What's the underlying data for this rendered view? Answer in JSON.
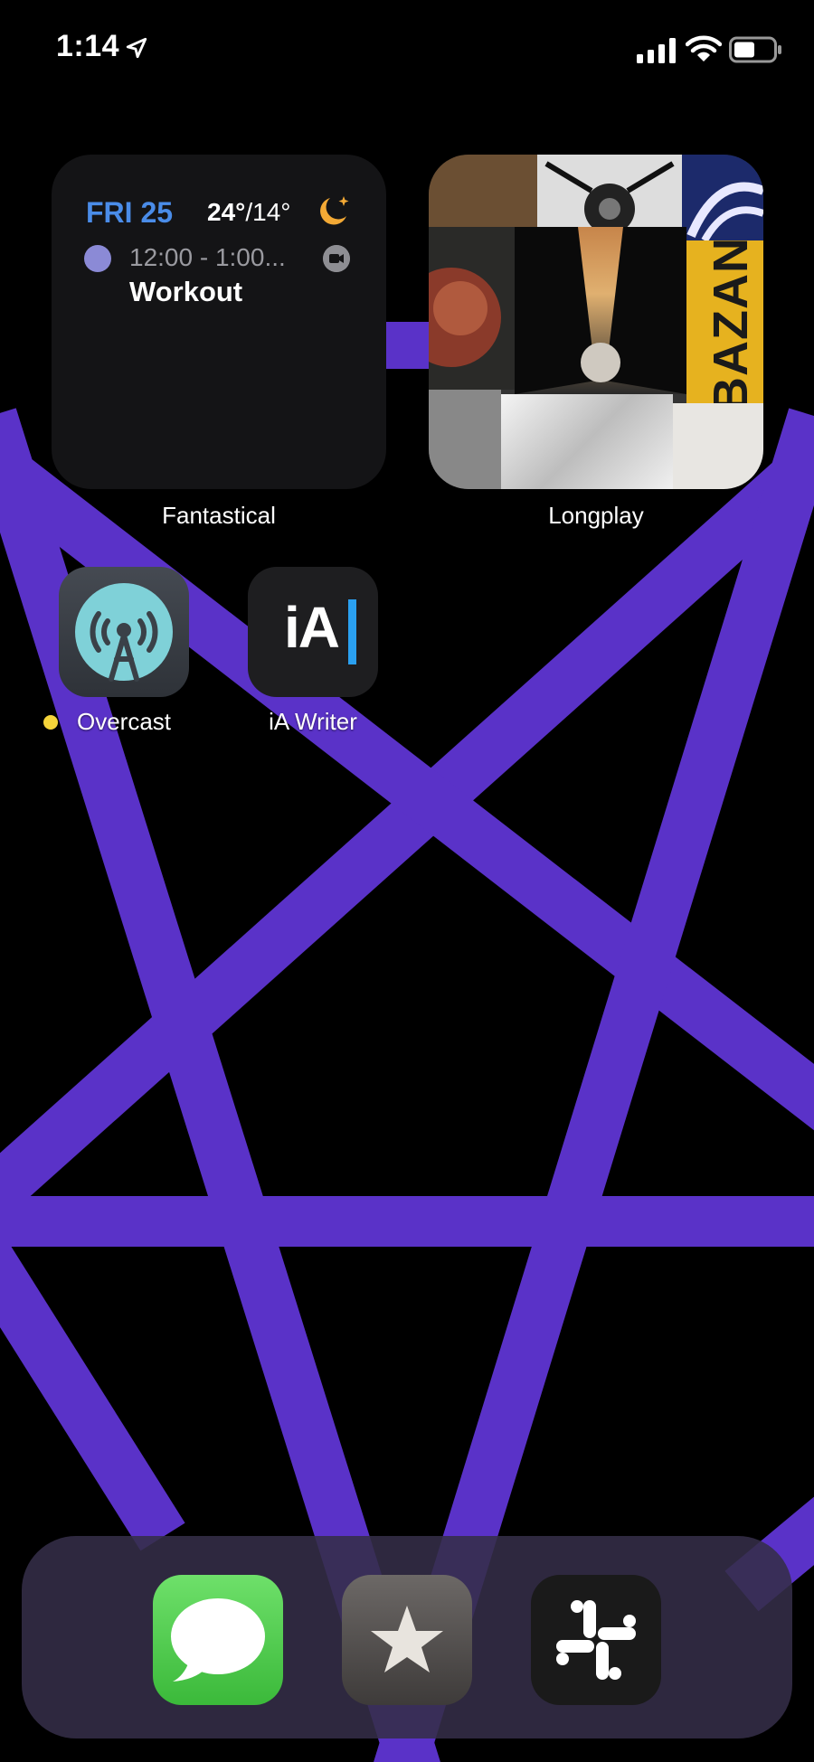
{
  "status_bar": {
    "time": "1:14",
    "icons": [
      "location-arrow-icon",
      "cellular-signal-icon",
      "wifi-icon",
      "battery-icon"
    ]
  },
  "wallpaper": {
    "background_color": "#000000",
    "pattern_color": "#5a32c8",
    "motif": "pentagram"
  },
  "fantastical_widget": {
    "date": "FRI 25",
    "temp_high": "24°",
    "temp_low": "/14°",
    "weather_icon": "moon-stars-icon",
    "event_time": "12:00 - 1:00...",
    "event_title": "Workout",
    "event_color": "#8b8ad6",
    "date_color": "#4a8ce8",
    "label": "Fantastical"
  },
  "longplay_widget": {
    "label": "Longplay",
    "album_art_text": "BAZAN"
  },
  "apps": [
    {
      "label": "Overcast",
      "icon": "podcast-tower-icon",
      "has_notification_dot": true
    },
    {
      "label": "iA Writer",
      "icon_text": "iA"
    }
  ],
  "dock": {
    "apps": [
      {
        "name": "Messages",
        "icon": "speech-bubble-icon"
      },
      {
        "name": "Reeder",
        "icon": "star-icon"
      },
      {
        "name": "Slack",
        "icon": "slack-hash-icon"
      }
    ]
  }
}
